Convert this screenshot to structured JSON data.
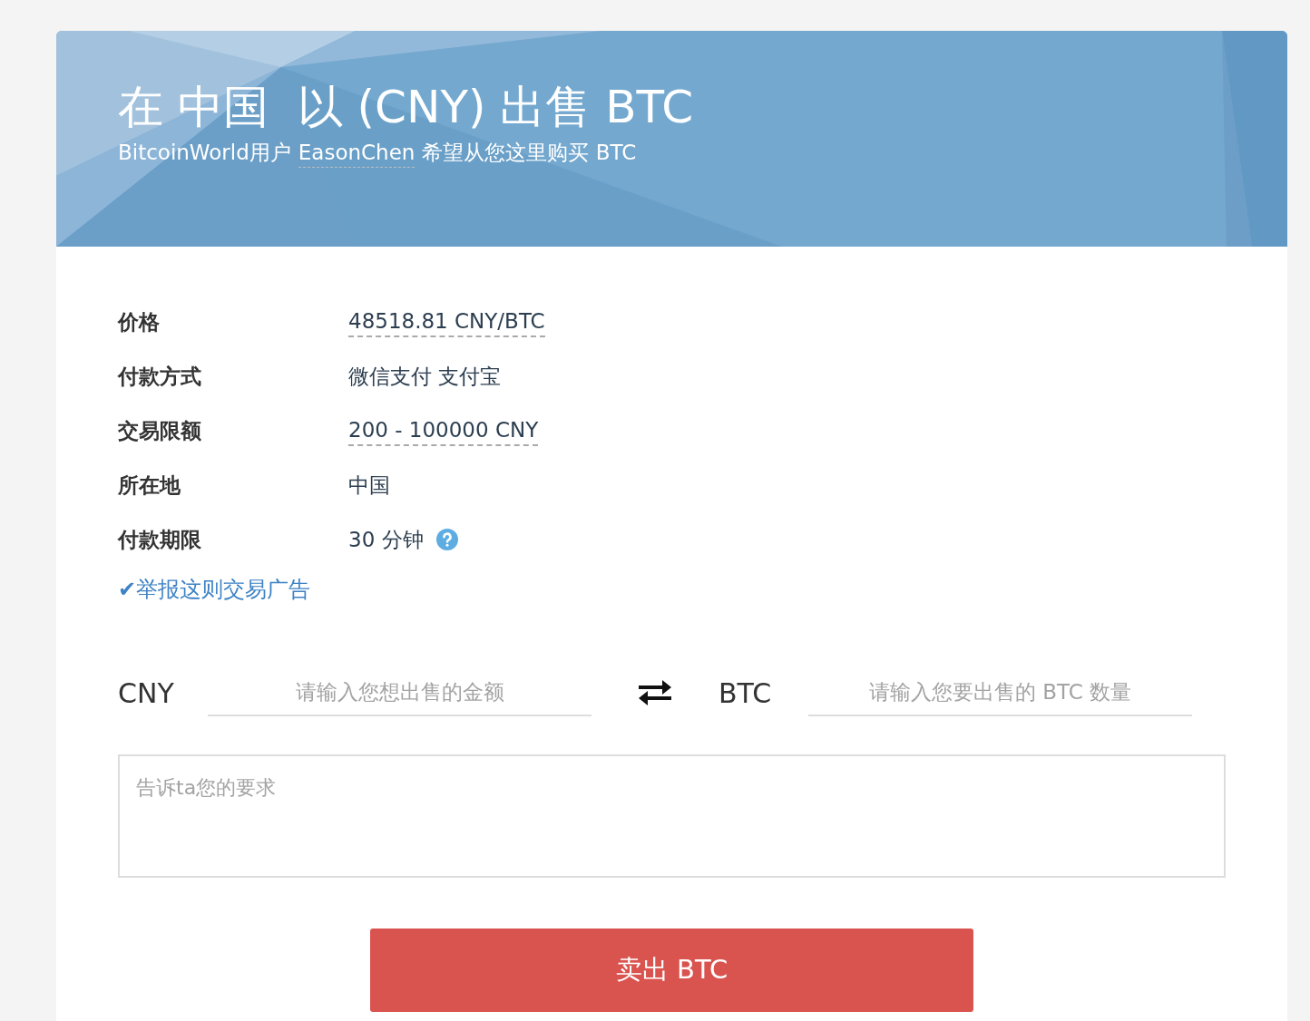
{
  "header": {
    "title": "在 中国  以 (CNY) 出售 BTC",
    "subtitle_prefix": "BitcoinWorld用户",
    "username": "EasonChen",
    "subtitle_suffix": "希望从您这里购买 BTC"
  },
  "details": [
    {
      "label": "价格",
      "value": "48518.81 CNY/BTC",
      "kind": "link"
    },
    {
      "label": "付款方式",
      "value": "微信支付 支付宝",
      "kind": "text"
    },
    {
      "label": "交易限额",
      "value": "200 - 100000 CNY",
      "kind": "link"
    },
    {
      "label": "所在地",
      "value": "中国",
      "kind": "text"
    },
    {
      "label": "付款期限",
      "value": "30 分钟",
      "kind": "help"
    }
  ],
  "report_link": "✔举报这则交易广告",
  "amount_fields": [
    {
      "currency": "CNY",
      "placeholder": "请输入您想出售的金额"
    },
    {
      "currency": "BTC",
      "placeholder": "请输入您要出售的 BTC 数量"
    }
  ],
  "message": {
    "placeholder": "告诉ta您的要求"
  },
  "submit_button": "卖出 BTC"
}
